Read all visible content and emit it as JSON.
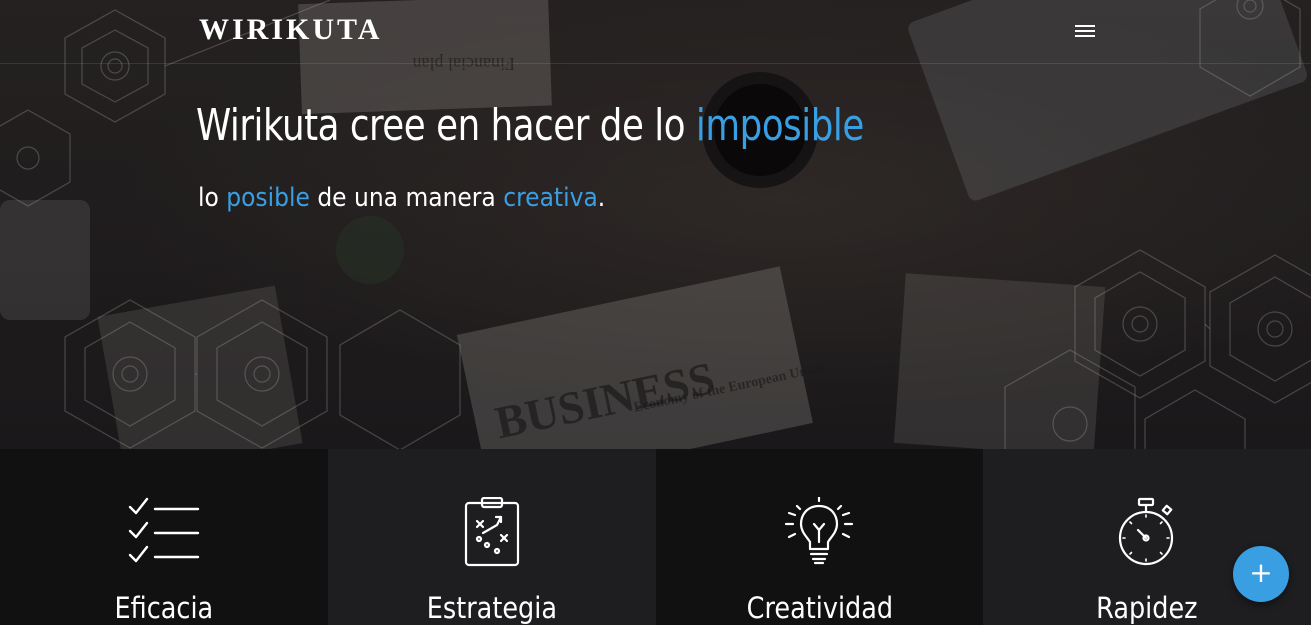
{
  "colors": {
    "accent": "#3a9ee3",
    "feature_dark": "#111112",
    "feature_mid": "#1e1e21",
    "fab": "#3a9ee3"
  },
  "nav": {
    "brand": "WIRIKUTA",
    "menu_icon": "hamburger-menu-icon"
  },
  "hero": {
    "headline_prefix": "Wirikuta cree en hacer de lo ",
    "headline_accent": "imposible",
    "sub_prefix": "lo ",
    "sub_accent_1": "posible",
    "sub_middle": " de una manera ",
    "sub_accent_2": "creativa",
    "sub_suffix": ".",
    "background_texts": [
      "Financial plan",
      "BUSINESS",
      "Economy of the European Union"
    ]
  },
  "features": [
    {
      "label": "Eficacia",
      "icon": "checklist-icon"
    },
    {
      "label": "Estrategia",
      "icon": "clipboard-strategy-icon"
    },
    {
      "label": "Creatividad",
      "icon": "lightbulb-icon"
    },
    {
      "label": "Rapidez",
      "icon": "stopwatch-icon"
    }
  ],
  "fab": {
    "label": "+",
    "icon": "plus-icon"
  }
}
